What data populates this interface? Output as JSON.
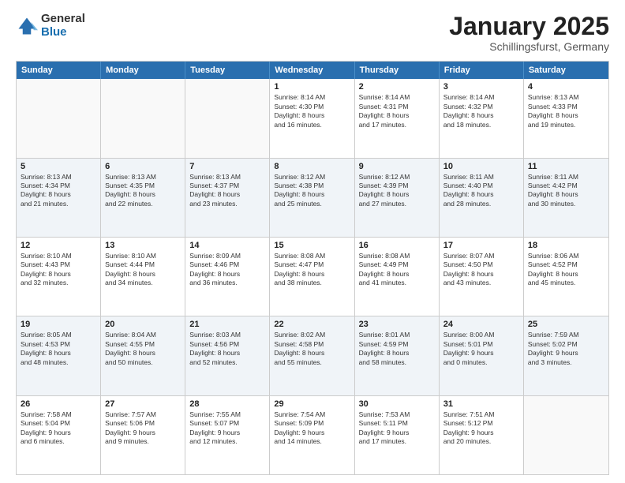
{
  "logo": {
    "general": "General",
    "blue": "Blue"
  },
  "title": {
    "month": "January 2025",
    "location": "Schillingsfurst, Germany"
  },
  "header_days": [
    "Sunday",
    "Monday",
    "Tuesday",
    "Wednesday",
    "Thursday",
    "Friday",
    "Saturday"
  ],
  "weeks": [
    [
      {
        "day": "",
        "data": ""
      },
      {
        "day": "",
        "data": ""
      },
      {
        "day": "",
        "data": ""
      },
      {
        "day": "1",
        "data": "Sunrise: 8:14 AM\nSunset: 4:30 PM\nDaylight: 8 hours\nand 16 minutes."
      },
      {
        "day": "2",
        "data": "Sunrise: 8:14 AM\nSunset: 4:31 PM\nDaylight: 8 hours\nand 17 minutes."
      },
      {
        "day": "3",
        "data": "Sunrise: 8:14 AM\nSunset: 4:32 PM\nDaylight: 8 hours\nand 18 minutes."
      },
      {
        "day": "4",
        "data": "Sunrise: 8:13 AM\nSunset: 4:33 PM\nDaylight: 8 hours\nand 19 minutes."
      }
    ],
    [
      {
        "day": "5",
        "data": "Sunrise: 8:13 AM\nSunset: 4:34 PM\nDaylight: 8 hours\nand 21 minutes."
      },
      {
        "day": "6",
        "data": "Sunrise: 8:13 AM\nSunset: 4:35 PM\nDaylight: 8 hours\nand 22 minutes."
      },
      {
        "day": "7",
        "data": "Sunrise: 8:13 AM\nSunset: 4:37 PM\nDaylight: 8 hours\nand 23 minutes."
      },
      {
        "day": "8",
        "data": "Sunrise: 8:12 AM\nSunset: 4:38 PM\nDaylight: 8 hours\nand 25 minutes."
      },
      {
        "day": "9",
        "data": "Sunrise: 8:12 AM\nSunset: 4:39 PM\nDaylight: 8 hours\nand 27 minutes."
      },
      {
        "day": "10",
        "data": "Sunrise: 8:11 AM\nSunset: 4:40 PM\nDaylight: 8 hours\nand 28 minutes."
      },
      {
        "day": "11",
        "data": "Sunrise: 8:11 AM\nSunset: 4:42 PM\nDaylight: 8 hours\nand 30 minutes."
      }
    ],
    [
      {
        "day": "12",
        "data": "Sunrise: 8:10 AM\nSunset: 4:43 PM\nDaylight: 8 hours\nand 32 minutes."
      },
      {
        "day": "13",
        "data": "Sunrise: 8:10 AM\nSunset: 4:44 PM\nDaylight: 8 hours\nand 34 minutes."
      },
      {
        "day": "14",
        "data": "Sunrise: 8:09 AM\nSunset: 4:46 PM\nDaylight: 8 hours\nand 36 minutes."
      },
      {
        "day": "15",
        "data": "Sunrise: 8:08 AM\nSunset: 4:47 PM\nDaylight: 8 hours\nand 38 minutes."
      },
      {
        "day": "16",
        "data": "Sunrise: 8:08 AM\nSunset: 4:49 PM\nDaylight: 8 hours\nand 41 minutes."
      },
      {
        "day": "17",
        "data": "Sunrise: 8:07 AM\nSunset: 4:50 PM\nDaylight: 8 hours\nand 43 minutes."
      },
      {
        "day": "18",
        "data": "Sunrise: 8:06 AM\nSunset: 4:52 PM\nDaylight: 8 hours\nand 45 minutes."
      }
    ],
    [
      {
        "day": "19",
        "data": "Sunrise: 8:05 AM\nSunset: 4:53 PM\nDaylight: 8 hours\nand 48 minutes."
      },
      {
        "day": "20",
        "data": "Sunrise: 8:04 AM\nSunset: 4:55 PM\nDaylight: 8 hours\nand 50 minutes."
      },
      {
        "day": "21",
        "data": "Sunrise: 8:03 AM\nSunset: 4:56 PM\nDaylight: 8 hours\nand 52 minutes."
      },
      {
        "day": "22",
        "data": "Sunrise: 8:02 AM\nSunset: 4:58 PM\nDaylight: 8 hours\nand 55 minutes."
      },
      {
        "day": "23",
        "data": "Sunrise: 8:01 AM\nSunset: 4:59 PM\nDaylight: 8 hours\nand 58 minutes."
      },
      {
        "day": "24",
        "data": "Sunrise: 8:00 AM\nSunset: 5:01 PM\nDaylight: 9 hours\nand 0 minutes."
      },
      {
        "day": "25",
        "data": "Sunrise: 7:59 AM\nSunset: 5:02 PM\nDaylight: 9 hours\nand 3 minutes."
      }
    ],
    [
      {
        "day": "26",
        "data": "Sunrise: 7:58 AM\nSunset: 5:04 PM\nDaylight: 9 hours\nand 6 minutes."
      },
      {
        "day": "27",
        "data": "Sunrise: 7:57 AM\nSunset: 5:06 PM\nDaylight: 9 hours\nand 9 minutes."
      },
      {
        "day": "28",
        "data": "Sunrise: 7:55 AM\nSunset: 5:07 PM\nDaylight: 9 hours\nand 12 minutes."
      },
      {
        "day": "29",
        "data": "Sunrise: 7:54 AM\nSunset: 5:09 PM\nDaylight: 9 hours\nand 14 minutes."
      },
      {
        "day": "30",
        "data": "Sunrise: 7:53 AM\nSunset: 5:11 PM\nDaylight: 9 hours\nand 17 minutes."
      },
      {
        "day": "31",
        "data": "Sunrise: 7:51 AM\nSunset: 5:12 PM\nDaylight: 9 hours\nand 20 minutes."
      },
      {
        "day": "",
        "data": ""
      }
    ]
  ]
}
